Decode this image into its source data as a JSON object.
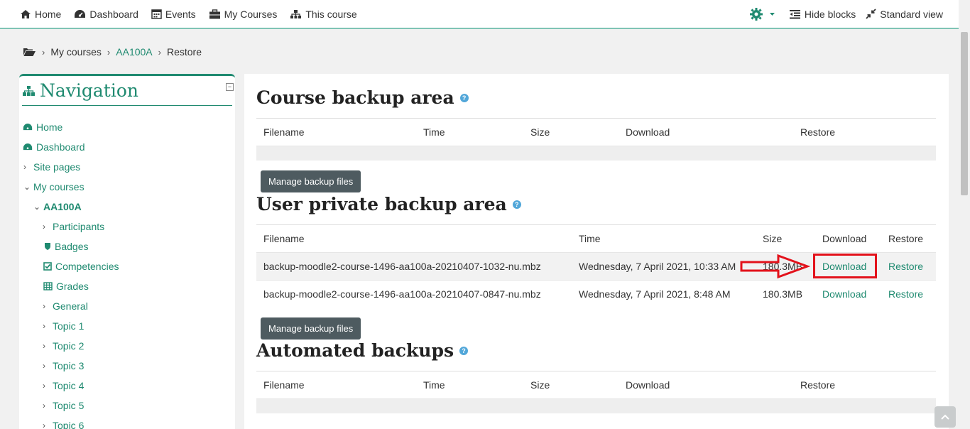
{
  "navbar": {
    "home": "Home",
    "dashboard": "Dashboard",
    "events": "Events",
    "my_courses": "My Courses",
    "this_course": "This course",
    "hide_blocks": "Hide blocks",
    "standard_view": "Standard view"
  },
  "breadcrumb": {
    "my_courses": "My courses",
    "course": "AA100A",
    "current": "Restore"
  },
  "sidebar": {
    "title": "Navigation",
    "items": [
      {
        "label": "Home"
      },
      {
        "label": "Dashboard"
      },
      {
        "label": "Site pages"
      },
      {
        "label": "My courses"
      },
      {
        "label": "AA100A"
      },
      {
        "label": "Participants"
      },
      {
        "label": "Badges"
      },
      {
        "label": "Competencies"
      },
      {
        "label": "Grades"
      },
      {
        "label": "General"
      },
      {
        "label": "Topic 1"
      },
      {
        "label": "Topic 2"
      },
      {
        "label": "Topic 3"
      },
      {
        "label": "Topic 4"
      },
      {
        "label": "Topic 5"
      },
      {
        "label": "Topic 6"
      }
    ]
  },
  "course_backup": {
    "heading": "Course backup area",
    "columns": [
      "Filename",
      "Time",
      "Size",
      "Download",
      "Restore"
    ],
    "manage_button": "Manage backup files"
  },
  "user_backup": {
    "heading": "User private backup area",
    "columns": [
      "Filename",
      "Time",
      "Size",
      "Download",
      "Restore"
    ],
    "rows": [
      {
        "filename": "backup-moodle2-course-1496-aa100a-20210407-1032-nu.mbz",
        "time": "Wednesday, 7 April 2021, 10:33 AM",
        "size": "180.3MB",
        "download": "Download",
        "restore": "Restore"
      },
      {
        "filename": "backup-moodle2-course-1496-aa100a-20210407-0847-nu.mbz",
        "time": "Wednesday, 7 April 2021, 8:48 AM",
        "size": "180.3MB",
        "download": "Download",
        "restore": "Restore"
      }
    ],
    "manage_button": "Manage backup files"
  },
  "automated_backup": {
    "heading": "Automated backups",
    "columns": [
      "Filename",
      "Time",
      "Size",
      "Download",
      "Restore"
    ]
  },
  "colors": {
    "accent": "#1f8a70",
    "highlight": "#e3121b",
    "button": "#4e5b60"
  }
}
